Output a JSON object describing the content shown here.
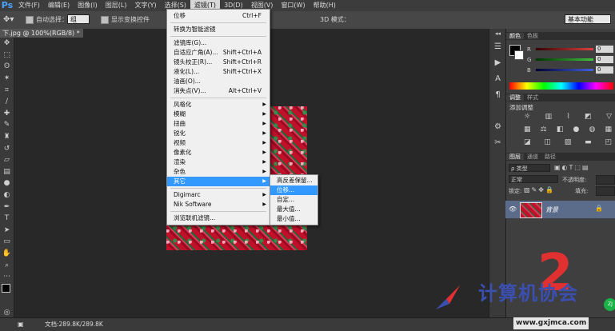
{
  "menubar": {
    "logo": "Ps",
    "items": [
      "文件(F)",
      "编辑(E)",
      "图像(I)",
      "图层(L)",
      "文字(Y)",
      "选择(S)",
      "滤镜(T)",
      "3D(D)",
      "视图(V)",
      "窗口(W)",
      "帮助(H)"
    ],
    "active_index": 6
  },
  "options": {
    "auto_select_label": "自动选择：",
    "auto_select_value": "组",
    "show_transform_label": "显示变换控件",
    "mode_3d_label": "3D 模式：",
    "workspace": "基本功能"
  },
  "document": {
    "tab_title": "下.jpg @ 100%(RGB/8) *"
  },
  "filter_menu": {
    "items": [
      {
        "label": "位移",
        "shortcut": "Ctrl+F"
      },
      {
        "sep": true
      },
      {
        "label": "转换为智能滤镜"
      },
      {
        "sep": true
      },
      {
        "label": "滤镜库(G)..."
      },
      {
        "label": "自适应广角(A)...",
        "shortcut": "Shift+Ctrl+A"
      },
      {
        "label": "镜头校正(R)...",
        "shortcut": "Shift+Ctrl+R"
      },
      {
        "label": "液化(L)...",
        "shortcut": "Shift+Ctrl+X"
      },
      {
        "label": "油画(O)..."
      },
      {
        "label": "消失点(V)...",
        "shortcut": "Alt+Ctrl+V"
      },
      {
        "sep": true
      },
      {
        "label": "风格化",
        "sub": true
      },
      {
        "label": "模糊",
        "sub": true
      },
      {
        "label": "扭曲",
        "sub": true
      },
      {
        "label": "锐化",
        "sub": true
      },
      {
        "label": "视频",
        "sub": true
      },
      {
        "label": "像素化",
        "sub": true
      },
      {
        "label": "渲染",
        "sub": true
      },
      {
        "label": "杂色",
        "sub": true
      },
      {
        "label": "其它",
        "sub": true,
        "highlight": true
      },
      {
        "sep": true
      },
      {
        "label": "Digimarc",
        "sub": true
      },
      {
        "label": "Nik Software",
        "sub": true
      },
      {
        "sep": true
      },
      {
        "label": "浏览联机滤镜..."
      }
    ]
  },
  "other_submenu": {
    "items": [
      "高反差保留...",
      "位移...",
      "自定...",
      "最大值...",
      "最小值..."
    ],
    "highlight_index": 1
  },
  "color_panel": {
    "tabs": [
      "颜色",
      "色板"
    ],
    "channels": [
      {
        "label": "R",
        "value": "0",
        "color": "#e04040"
      },
      {
        "label": "G",
        "value": "0",
        "color": "#40c040"
      },
      {
        "label": "B",
        "value": "0",
        "color": "#4060e0"
      }
    ]
  },
  "adjust_panel": {
    "tabs": [
      "调整",
      "样式"
    ],
    "title": "添加调整"
  },
  "layers_panel": {
    "tabs": [
      "图层",
      "通道",
      "路径"
    ],
    "kind": "ρ 类型",
    "blend": "正常",
    "opacity_label": "不透明度:",
    "lock_label": "锁定:",
    "fill_label": "填充:",
    "layer_name": "背景"
  },
  "status": {
    "doc_info": "文档:289.8K/289.8K"
  },
  "watermark": {
    "number": "2",
    "site_cn": "计算机协会",
    "site_url": "www.gxjmca.com"
  },
  "colors": {
    "menu_highlight": "#3399ff",
    "ui_dark": "#282828"
  }
}
